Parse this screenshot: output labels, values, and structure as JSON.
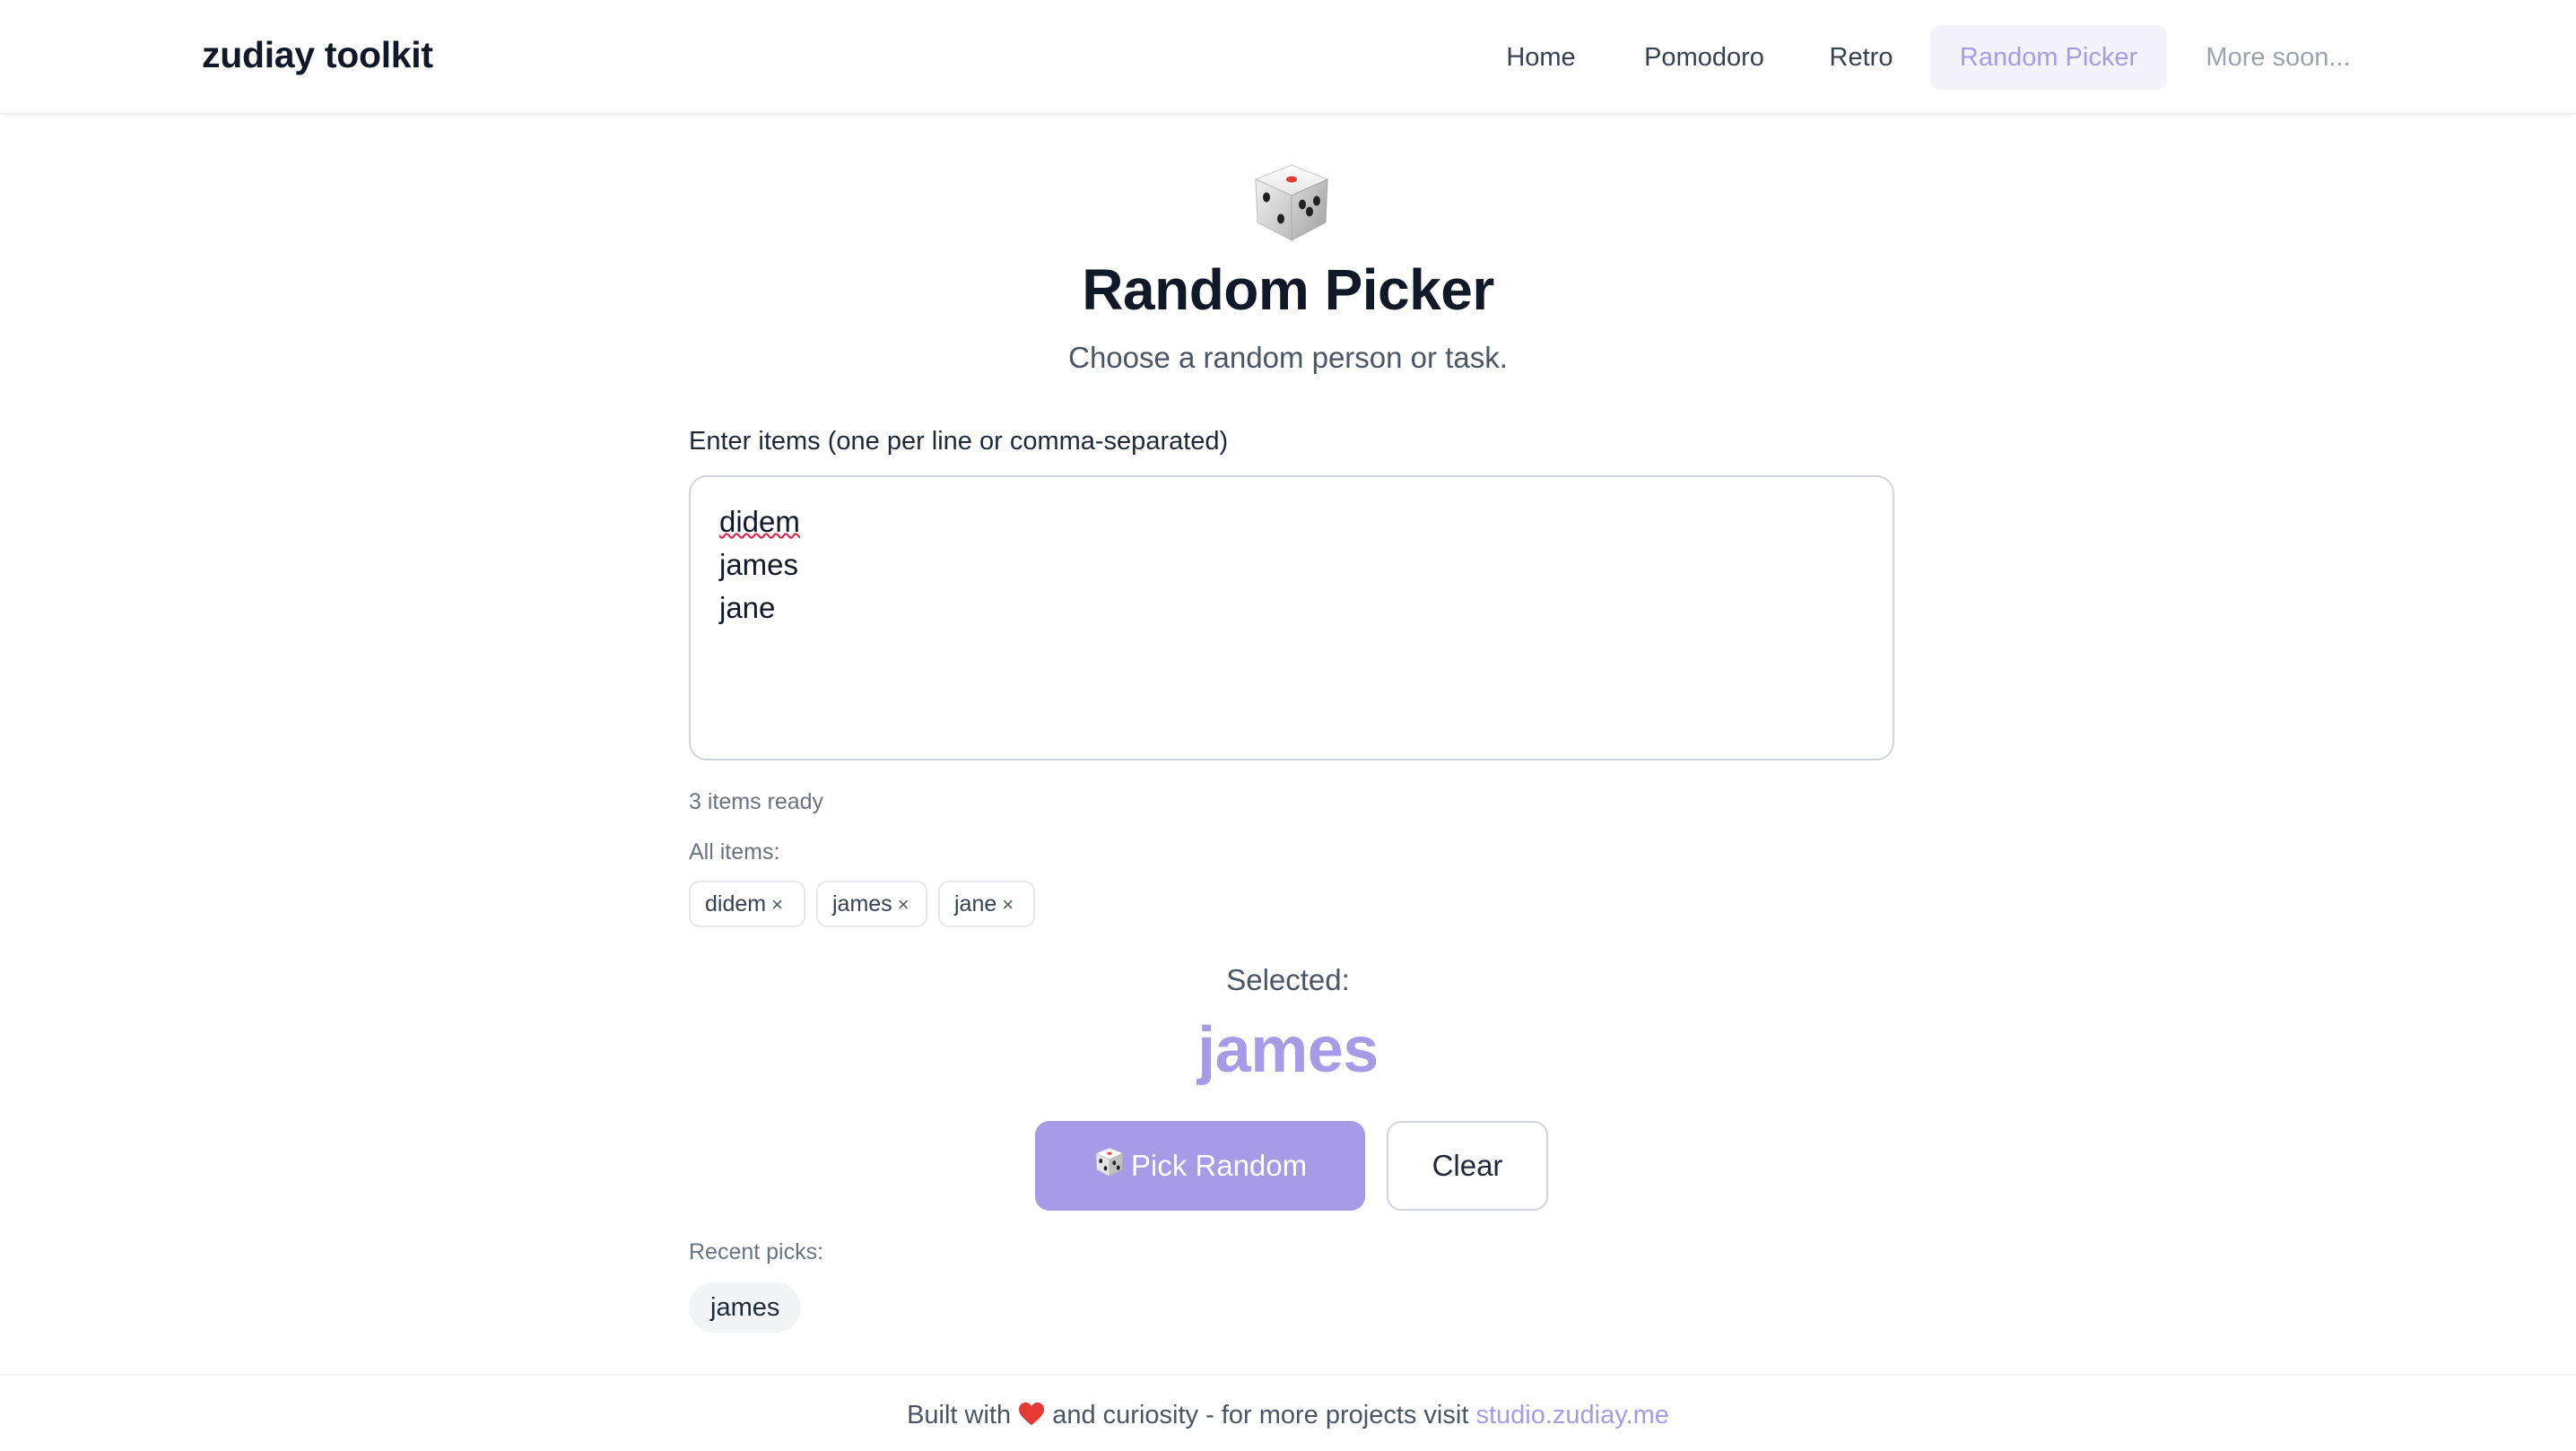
{
  "header": {
    "brand": "zudiay toolkit",
    "nav": [
      {
        "label": "Home",
        "active": false
      },
      {
        "label": "Pomodoro",
        "active": false
      },
      {
        "label": "Retro",
        "active": false
      },
      {
        "label": "Random Picker",
        "active": true
      },
      {
        "label": "More soon...",
        "active": false
      }
    ]
  },
  "hero": {
    "icon": "dice-icon",
    "title": "Random Picker",
    "subtitle": "Choose a random person or task."
  },
  "input": {
    "label": "Enter items (one per line or comma-separated)",
    "lines": [
      "didem",
      "james",
      "jane"
    ],
    "status": "3 items ready"
  },
  "items": {
    "label": "All items:",
    "chips": [
      "didem",
      "james",
      "jane"
    ],
    "remove_glyph": "×"
  },
  "selection": {
    "label": "Selected:",
    "value": "james"
  },
  "actions": {
    "pick_label": "Pick Random",
    "pick_icon": "dice-icon",
    "clear_label": "Clear"
  },
  "recent": {
    "label": "Recent picks:",
    "items": [
      "james"
    ]
  },
  "footer": {
    "text_before": "Built with",
    "heart_icon": "heart-icon",
    "text_after": "and curiosity - for more projects visit",
    "link": "studio.zudiay.me"
  },
  "colors": {
    "accent": "#a79be8",
    "accent_bg": "#f4f3fc",
    "text": "#111827",
    "muted": "#6b7280"
  }
}
